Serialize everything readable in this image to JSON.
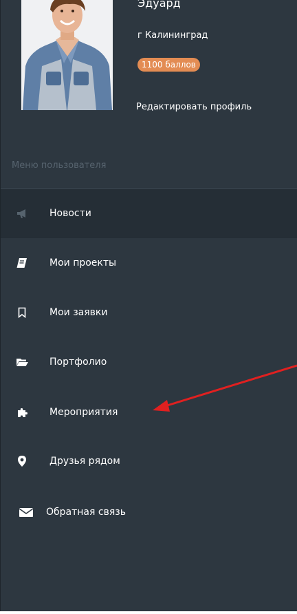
{
  "profile": {
    "name": "Эдуард",
    "city": "г Калининград",
    "points": "1100 баллов",
    "edit_link": "Редактировать профиль"
  },
  "menu": {
    "header": "Меню пользователя",
    "items": [
      {
        "label": "Новости",
        "icon": "bullhorn-icon"
      },
      {
        "label": "Мои проекты",
        "icon": "book-icon"
      },
      {
        "label": "Мои заявки",
        "icon": "bookmark-icon"
      },
      {
        "label": "Портфолио",
        "icon": "folder-open-icon"
      },
      {
        "label": "Мероприятия",
        "icon": "puzzle-icon"
      },
      {
        "label": "Друзья рядом",
        "icon": "map-marker-icon"
      },
      {
        "label": "Обратная связь",
        "icon": "envelope-icon"
      }
    ]
  },
  "colors": {
    "sidebar_bg": "#2d3740",
    "active_item_bg": "#252e36",
    "badge": "#e38c53",
    "annotation_arrow": "#e02020"
  }
}
